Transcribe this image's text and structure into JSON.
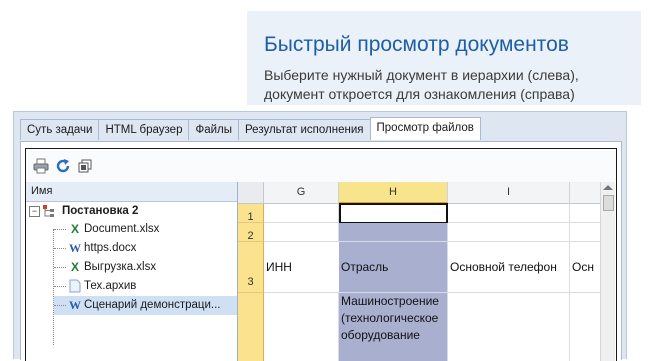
{
  "banner": {
    "title": "Быстрый просмотр документов",
    "subtitle": "Выберите нужный документ в иерархии (слева), документ откроется для ознакомления (справа)"
  },
  "tabs": [
    {
      "label": "Суть задачи",
      "active": false
    },
    {
      "label": "HTML браузер",
      "active": false
    },
    {
      "label": "Файлы",
      "active": false
    },
    {
      "label": "Результат исполнения",
      "active": false
    },
    {
      "label": "Просмотр файлов",
      "active": true
    }
  ],
  "toolbar": {
    "icons": [
      "printer-icon",
      "refresh-icon",
      "copy-icon"
    ]
  },
  "tree": {
    "header": "Имя",
    "root": {
      "label": "Постановка 2",
      "icon": "hierarchy-icon",
      "expanded": true
    },
    "items": [
      {
        "label": "Document.xlsx",
        "icon": "excel-icon"
      },
      {
        "label": "https.docx",
        "icon": "word-icon"
      },
      {
        "label": "Выгрузка.xlsx",
        "icon": "excel-icon"
      },
      {
        "label": "Тех.архив",
        "icon": "file-icon"
      },
      {
        "label": "Сценарий демонстраци...",
        "icon": "word-icon"
      }
    ]
  },
  "sheet": {
    "columns": [
      "G",
      "H",
      "I",
      ""
    ],
    "selected_column": "H",
    "rows": [
      "1",
      "2",
      "3",
      ""
    ],
    "cells": {
      "row3": [
        "ИНН",
        "Отрасль",
        "Основной телефон",
        "Осн"
      ],
      "row4_H": "Машиностроение (технологическое оборудование"
    }
  },
  "colors": {
    "accent": "#1f5fa6",
    "row_header": "#fbe28e",
    "selected_col": "#a9b0cf"
  }
}
